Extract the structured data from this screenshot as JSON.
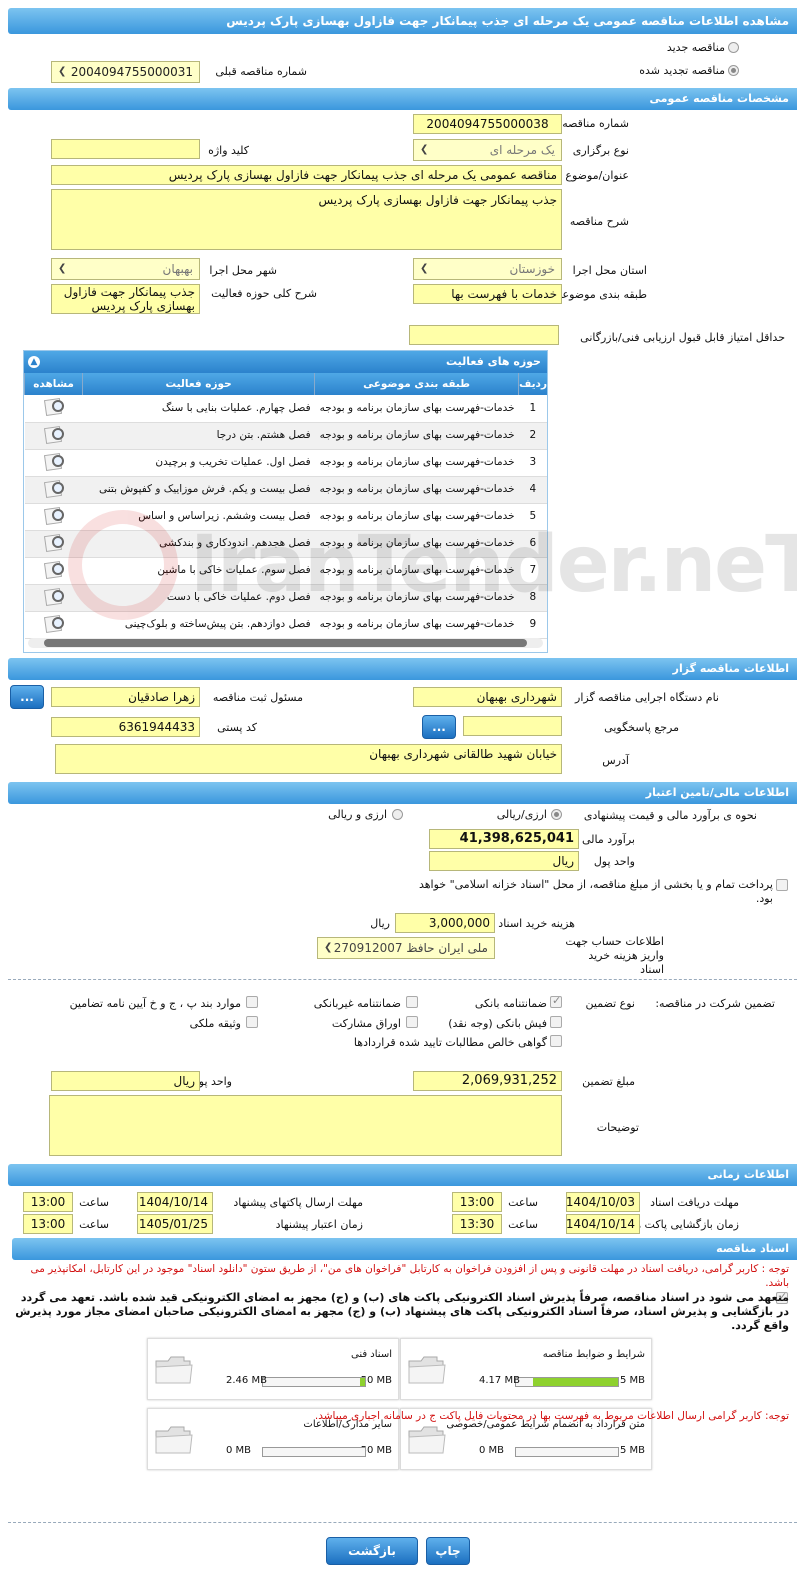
{
  "page_title": "مشاهده اطلاعات مناقصه عمومی یک مرحله ای جذب پیمانکار جهت فازاول بهسازی پارک پردیس",
  "type_options": {
    "new": "مناقصه جدید",
    "renewed": "مناقصه تجدید شده",
    "previous_label": "شماره مناقصه قبلی",
    "previous_value": "2004094755000031"
  },
  "general": {
    "header": "مشخصات مناقصه عمومی",
    "number_label": "شماره مناقصه",
    "number": "2004094755000038",
    "method_label": "نوع برگزاری",
    "method": "یک مرحله ای",
    "keyword_label": "کلید واژه",
    "keyword": "",
    "title_label": "عنوان/موضوع مناقصه",
    "title": "مناقصه عمومی یک مرحله ای جذب پیمانکار جهت فازاول بهسازی پارک پردیس",
    "desc_label": "شرح مناقصه",
    "desc": "جذب پیمانکار جهت فازاول بهسازی پارک پردیس",
    "province_label": "استان محل اجرا",
    "province": "خوزستان",
    "city_label": "شهر محل اجرا",
    "city": "بهبهان",
    "category_label": "طبقه بندی موضوعی",
    "category": "خدمات با فهرست بها",
    "scope_label": "شرح کلی حوزه فعالیت",
    "scope": "جذب پیمانکار جهت فازاول بهسازی پارک پردیس",
    "min_score_label": "حداقل امتیاز قابل قبول ارزیابی فنی/بازرگانی",
    "min_score": ""
  },
  "activities": {
    "header": "حوزه های فعالیت",
    "cols": [
      "ردیف",
      "طبقه بندی موضوعی",
      "حوزه فعالیت",
      "مشاهده"
    ],
    "rows": [
      {
        "n": "1",
        "cat": "خدمات-فهرست بهای سازمان برنامه و بودجه",
        "act": "فصل چهارم. عملیات بنایی با سنگ"
      },
      {
        "n": "2",
        "cat": "خدمات-فهرست بهای سازمان برنامه و بودجه",
        "act": "فصل هشتم. بتن درجا"
      },
      {
        "n": "3",
        "cat": "خدمات-فهرست بهای سازمان برنامه و بودجه",
        "act": "فصل اول. عملیات تخریب و برچیدن"
      },
      {
        "n": "4",
        "cat": "خدمات-فهرست بهای سازمان برنامه و بودجه",
        "act": "فصل بیست و یکم. فرش موزاییک و کفپوش بتنی"
      },
      {
        "n": "5",
        "cat": "خدمات-فهرست بهای سازمان برنامه و بودجه",
        "act": "فصل بیست وششم. زیراساس و اساس"
      },
      {
        "n": "6",
        "cat": "خدمات-فهرست بهای سازمان برنامه و بودجه",
        "act": "فصل هجدهم. اندودکاری و بندکشی"
      },
      {
        "n": "7",
        "cat": "خدمات-فهرست بهای سازمان برنامه و بودجه",
        "act": "فصل سوم. عملیات خاکی با ماشین"
      },
      {
        "n": "8",
        "cat": "خدمات-فهرست بهای سازمان برنامه و بودجه",
        "act": "فصل دوم. عملیات خاکی با دست"
      },
      {
        "n": "9",
        "cat": "خدمات-فهرست بهای سازمان برنامه و بودجه",
        "act": "فصل دوازدهم. بتن پیش‌ساخته و بلوک‌چینی"
      }
    ]
  },
  "organizer": {
    "header": "اطلاعات مناقصه گزار",
    "org_label": "نام دستگاه اجرایی مناقصه گزار",
    "org": "شهرداری بهبهان",
    "officer_label": "مسئول ثبت مناقصه",
    "officer": "زهرا صادقیان",
    "ref_label": "مرجع پاسخگویی",
    "ref": "",
    "postal_label": "کد پستی",
    "postal": "6361944433",
    "address_label": "آدرس",
    "address": "خیابان شهید طالقانی شهرداری بهبهان",
    "more": "..."
  },
  "finance": {
    "header": "اطلاعات مالی/تامین اعتبار",
    "estimate_method_label": "نحوه ی برآورد مالی و قیمت پیشنهادی",
    "opt1": "ارزی/ریالی",
    "opt2": "ارزی و ریالی",
    "estimate_label": "برآورد مالی",
    "estimate": "41,398,625,041",
    "currency_label": "واحد پول",
    "currency": "ریال",
    "treasury_text": "پرداخت تمام و یا بخشی از مبلغ مناقصه، از محل \"اسناد خزانه اسلامی\" خواهد بود.",
    "doc_fee_label": "هزینه خرید اسناد",
    "doc_fee": "3,000,000",
    "doc_fee_unit": "ریال",
    "account_label": "اطلاعات حساب جهت واریز هزینه خرید اسناد",
    "account": "ملی ایران حافظ 270912007"
  },
  "guarantee": {
    "label": "تضمین شرکت در مناقصه:",
    "type_label": "نوع تضمین",
    "opts": [
      "ضمانتنامه بانکی",
      "ضمانتنامه غیربانکی",
      "موارد بند پ ، ج و خ آیین نامه تضامین",
      "فیش بانکی (وجه نقد)",
      "اوراق مشارکت",
      "وثیقه ملکی",
      "گواهی خالص مطالبات تایید شده قراردادها"
    ],
    "amount_label": "مبلغ تضمین",
    "amount": "2,069,931,252",
    "currency_label": "واحد پول",
    "currency": "ریال",
    "notes_label": "توضیحات",
    "notes": ""
  },
  "timing": {
    "header": "اطلاعات زمانی",
    "doc_receive_label": "مهلت دریافت اسناد",
    "doc_receive_date": "1404/10/03",
    "doc_receive_time": "13:00",
    "send_label": "مهلت ارسال پاکتهای پیشنهاد",
    "send_date": "1404/10/14",
    "send_time": "13:00",
    "open_label": "زمان بازگشایی پاکت ها",
    "open_date": "1404/10/14",
    "open_time": "13:30",
    "valid_label": "زمان اعتبار پیشنهاد",
    "valid_date": "1405/01/25",
    "valid_time": "13:00",
    "time_label": "ساعت"
  },
  "docs": {
    "header": "اسناد مناقصه",
    "notice": "توجه : کاربر گرامی، دریافت اسناد در مهلت قانونی و پس از افزودن فراخوان به کارتابل \"فراخوان های من\"، از طریق ستون \"دانلود اسناد\" موجود در این کارتابل، امکانپذیر می باشد.",
    "commit": "متعهد می شود در اسناد مناقصه، صرفاً پذیرش اسناد الکترونیکی پاکت های (ب) و (ج) مجهز به امضای الکترونیکی قید شده باشد. تعهد می گردد در بازگشایی و پذیرش اسناد، صرفاً اسناد الکترونیکی پاکت های پیشنهاد (ب) و (ج) مجهز به امضای الکترونیکی صاحبان امضای مجاز مورد پذیرش واقع گردد.",
    "cards": [
      {
        "title": "شرایط و ضوابط مناقصه",
        "used": "4.17 MB",
        "max": "5 MB",
        "pct": 0.83
      },
      {
        "title": "اسناد فنی",
        "used": "2.46 MB",
        "max": "50 MB",
        "pct": 0.05
      },
      {
        "title": "متن قرارداد به انضمام شرایط عمومی/خصوصی",
        "used": "0 MB",
        "max": "5 MB",
        "pct": 0
      },
      {
        "title": "سایر مدارک/اطلاعات",
        "used": "0 MB",
        "max": "50 MB",
        "pct": 0
      }
    ],
    "footer_note": "توجه: کاربر گرامی ارسال اطلاعات مربوط به فهرست بها در محتویات فایل پاکت ج در سامانه اجباری میباشد."
  },
  "buttons": {
    "print": "چاپ",
    "back": "بازگشت"
  },
  "watermark": "IranTender.neT"
}
